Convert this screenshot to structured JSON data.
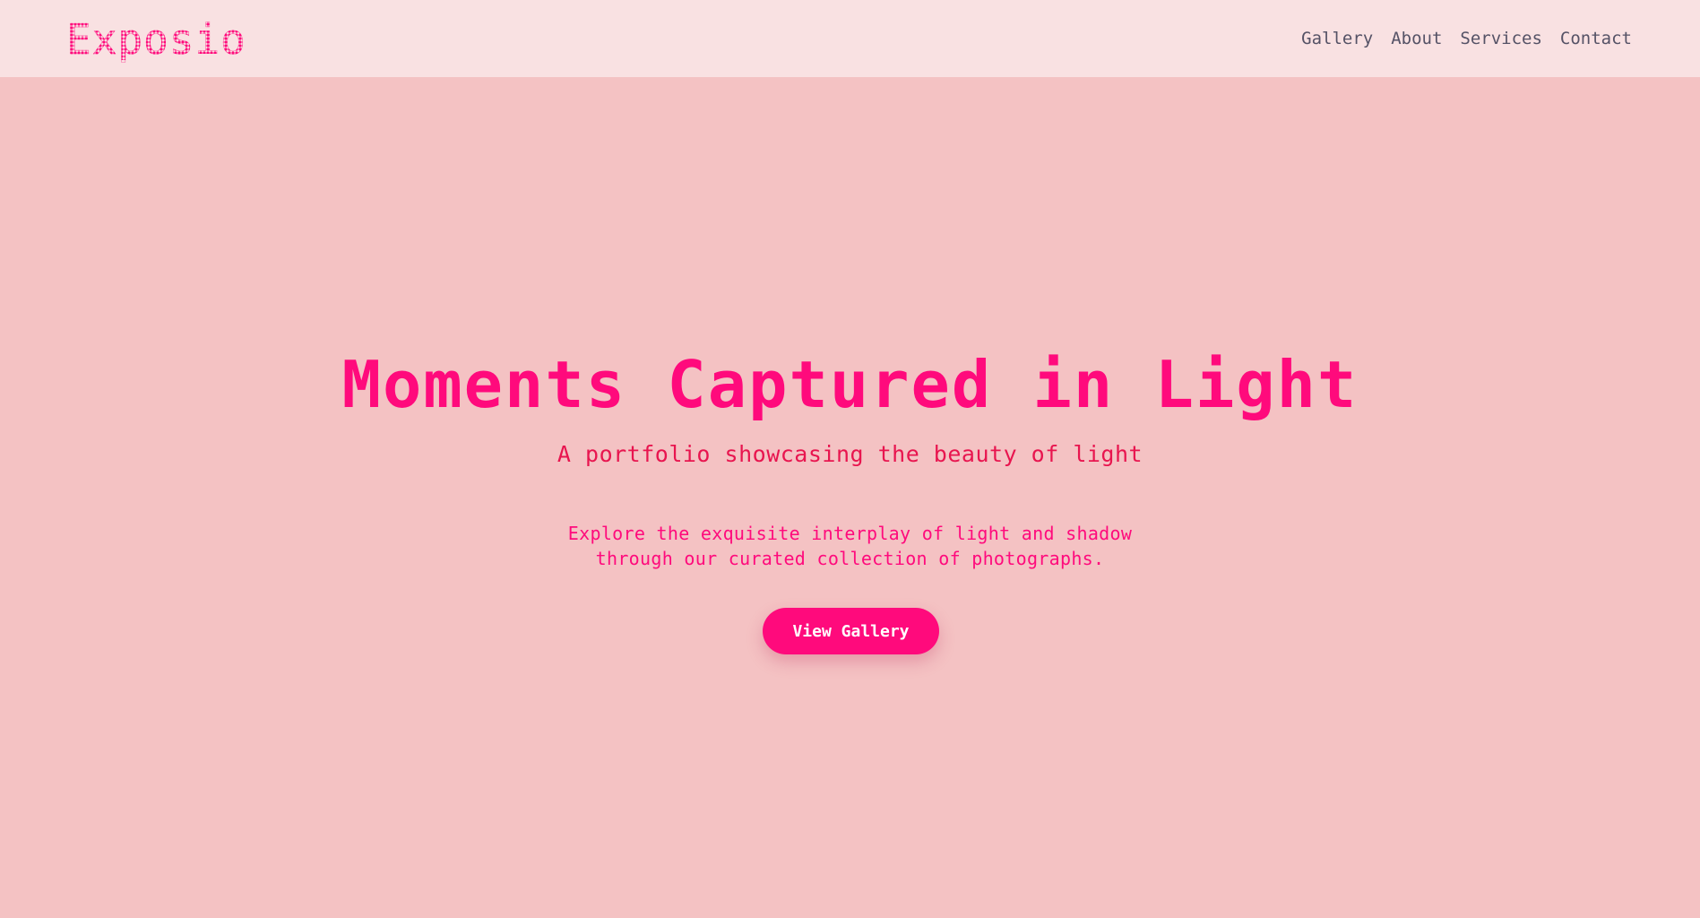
{
  "header": {
    "logo": "Exposio",
    "nav": [
      {
        "label": "Gallery"
      },
      {
        "label": "About"
      },
      {
        "label": "Services"
      },
      {
        "label": "Contact"
      }
    ]
  },
  "hero": {
    "title": "Moments Captured in Light",
    "subtitle": "A portfolio showcasing the beauty of light",
    "description_line1": "Explore the exquisite interplay of light and shadow",
    "description_line2": "through our curated collection of photographs.",
    "cta_label": "View Gallery"
  },
  "colors": {
    "background": "#f4c2c3",
    "header_background": "#f9e1e2",
    "accent": "#ff0a7c",
    "subtitle": "#e8154f",
    "nav_text": "#555266"
  }
}
